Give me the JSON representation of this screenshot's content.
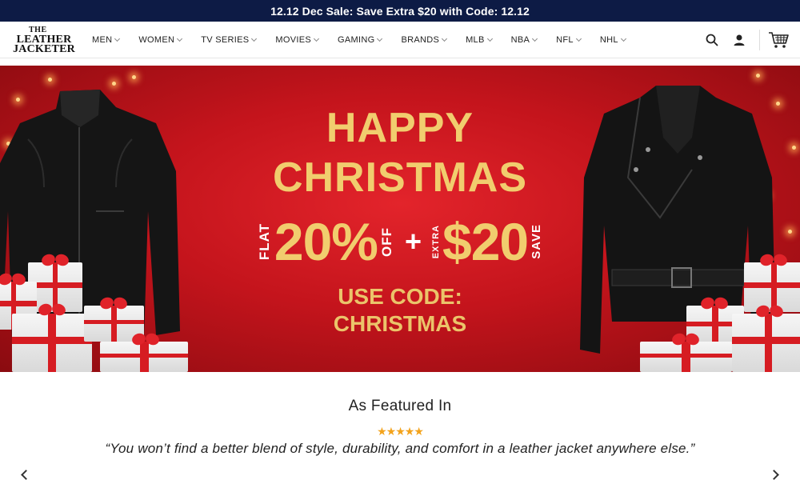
{
  "promo": {
    "text": "12.12 Dec Sale: Save Extra $20 with Code: 12.12"
  },
  "logo": {
    "line1": "THE",
    "line2": "LEATHER",
    "line3": "JACKETER"
  },
  "nav": [
    {
      "label": "MEN"
    },
    {
      "label": "WOMEN"
    },
    {
      "label": "TV SERIES"
    },
    {
      "label": "MOVIES"
    },
    {
      "label": "GAMING"
    },
    {
      "label": "BRANDS"
    },
    {
      "label": "MLB"
    },
    {
      "label": "NBA"
    },
    {
      "label": "NFL"
    },
    {
      "label": "NHL"
    }
  ],
  "header_icons": [
    "search-icon",
    "account-icon",
    "cart-icon"
  ],
  "hero": {
    "line1": "HAPPY",
    "line2": "CHRISTMAS",
    "flat": "FLAT",
    "pct": "20%",
    "off": "OFF",
    "plus": "+",
    "extra": "EXTRA",
    "amount": "$20",
    "save": "SAVE",
    "use_code": "USE CODE:",
    "code": "CHRISTMAS",
    "colors": {
      "background": "#c4141c",
      "text_gold": "#f1cd6e"
    }
  },
  "featured": {
    "title": "As Featured In",
    "stars": "★★★★★",
    "quote": "“You won’t find a better blend of style, durability, and comfort in a leather jacket anywhere else.”"
  },
  "colors": {
    "promo_bar": "#0d1b45",
    "star": "#f3a31c"
  }
}
